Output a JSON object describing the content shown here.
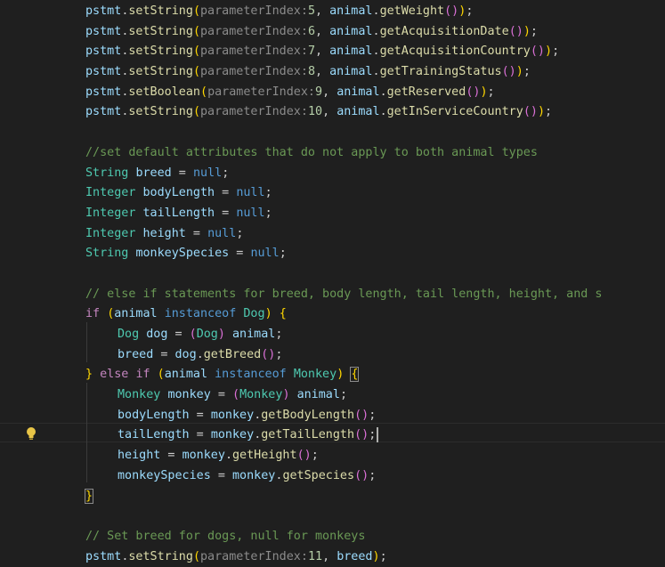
{
  "editor": {
    "comments": {
      "defaults": "//set default attributes that do not apply to both animal types",
      "elseif": "// else if statements for breed, body length, tail length, height, and s",
      "breed": "// Set breed for dogs, null for monkeys"
    },
    "hints": {
      "p5": "parameterIndex:",
      "p6": "parameterIndex:",
      "p7": "parameterIndex:",
      "p8": "parameterIndex:",
      "p9": "parameterIndex:",
      "p10": "parameterIndex:",
      "p11": "parameterIndex:"
    },
    "numbers": {
      "n5": "5",
      "n6": "6",
      "n7": "7",
      "n8": "8",
      "n9": "9",
      "n10": "10",
      "n11": "11"
    },
    "methods": {
      "setString": "setString",
      "setBoolean": "setBoolean",
      "getWeight": "getWeight",
      "getAcquisitionDate": "getAcquisitionDate",
      "getAcquisitionCountry": "getAcquisitionCountry",
      "getTrainingStatus": "getTrainingStatus",
      "getReserved": "getReserved",
      "getInServiceCountry": "getInServiceCountry",
      "getBreed": "getBreed",
      "getBodyLength": "getBodyLength",
      "getTailLength": "getTailLength",
      "getHeight": "getHeight",
      "getSpecies": "getSpecies"
    },
    "vars": {
      "pstmt": "pstmt",
      "animal": "animal",
      "breed": "breed",
      "bodyLength": "bodyLength",
      "tailLength": "tailLength",
      "height": "height",
      "monkeySpecies": "monkeySpecies",
      "dog": "dog",
      "monkey": "monkey"
    },
    "types": {
      "String": "String",
      "Integer": "Integer",
      "Dog": "Dog",
      "Monkey": "Monkey"
    },
    "keywords": {
      "null": "null",
      "if": "if",
      "else": "else",
      "instanceof": "instanceof"
    }
  }
}
